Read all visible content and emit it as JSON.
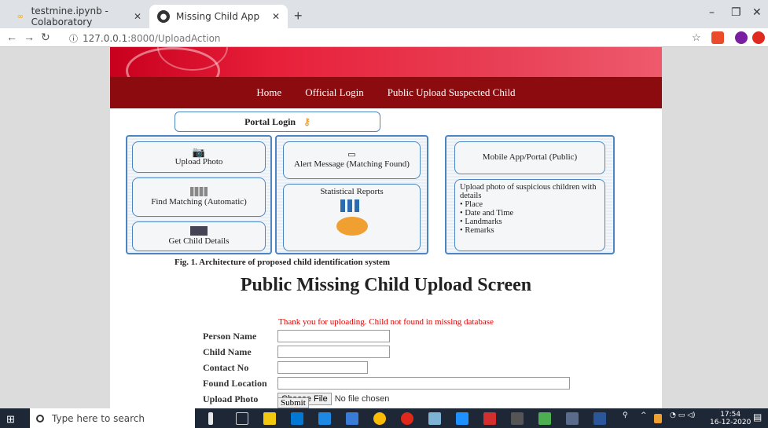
{
  "browser": {
    "tabs": [
      {
        "title": "testmine.ipynb - Colaboratory",
        "icon": "colab-icon"
      },
      {
        "title": "Missing Child App",
        "icon": "globe-icon"
      }
    ],
    "url_host": "127.0.0.1",
    "url_path": ":8000/UploadAction"
  },
  "nav": {
    "home": "Home",
    "official_login": "Official Login",
    "public_upload": "Public Upload Suspected Child"
  },
  "architecture": {
    "portal_login": "Portal Login",
    "upload_photo": "Upload Photo",
    "find_matching": "Find Matching (Automatic)",
    "get_child_details": "Get Child Details",
    "alert_message": "Alert Message (Matching Found)",
    "statistical_reports": "Statistical Reports",
    "mobile_app": "Mobile App/Portal (Public)",
    "upload_details_title": "Upload photo of suspicious children with details",
    "upload_details_items": [
      "Place",
      "Date and Time",
      "Landmarks",
      "Remarks"
    ],
    "caption": "Fig. 1.   Architecture of proposed child identification system"
  },
  "page": {
    "heading": "Public Missing Child Upload Screen",
    "message": "Thank you for uploading. Child not found in missing database"
  },
  "form": {
    "person_name_label": "Person Name",
    "child_name_label": "Child Name",
    "contact_no_label": "Contact No",
    "found_location_label": "Found Location",
    "upload_photo_label": "Upload Photo",
    "choose_file_label": "Choose File",
    "no_file_text": "No file chosen",
    "submit_label": "Submit"
  },
  "taskbar": {
    "search_placeholder": "Type here to search",
    "time": "17:54",
    "date": "16-12-2020"
  }
}
